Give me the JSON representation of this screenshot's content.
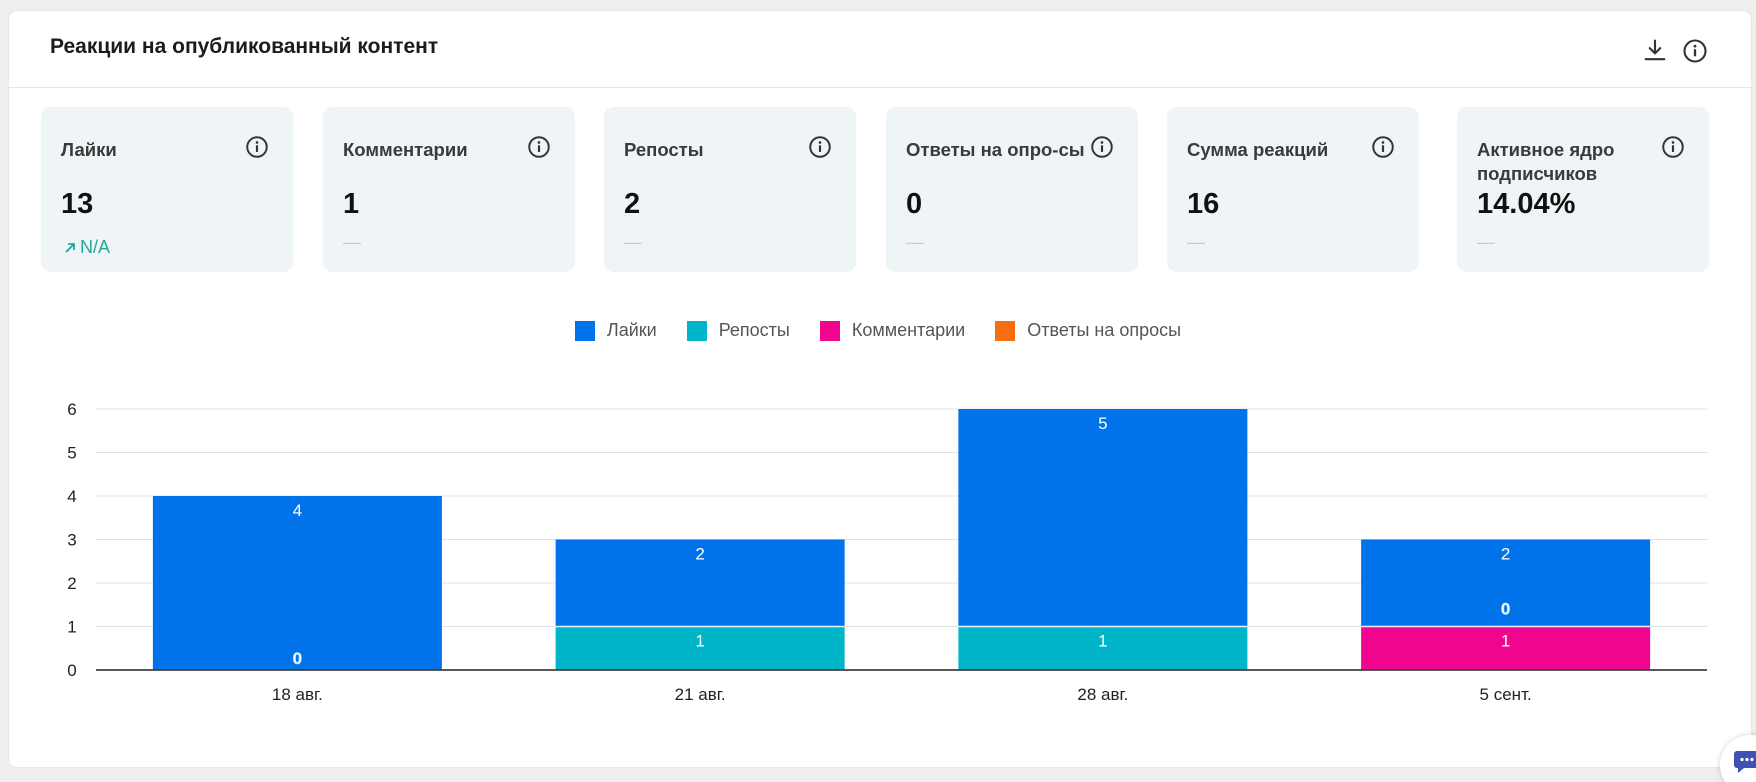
{
  "title": "Реакции на опубликованный контент",
  "icons": {
    "download": "download-icon",
    "info": "info-icon"
  },
  "metrics": [
    {
      "label": "Лайки",
      "value": "13",
      "trend": "N/A",
      "trend_icon": "arrow-up-right-icon"
    },
    {
      "label": "Комментарии",
      "value": "1",
      "trend": "—"
    },
    {
      "label": "Репосты",
      "value": "2",
      "trend": "—"
    },
    {
      "label": "Ответы на опро-сы",
      "value": "0",
      "trend": "—"
    },
    {
      "label": "Сумма реакций",
      "value": "16",
      "trend": "—"
    },
    {
      "label": "Активное ядро подписчиков",
      "value": "14.04%",
      "trend": "—"
    }
  ],
  "colors": {
    "likes": "#0073ea",
    "reposts": "#00b5c8",
    "comments": "#f0058e",
    "polls": "#f56e0f",
    "trend": "#26a69a"
  },
  "legend": [
    {
      "label": "Лайки",
      "color": "#0073ea"
    },
    {
      "label": "Репосты",
      "color": "#00b5c8"
    },
    {
      "label": "Комментарии",
      "color": "#f0058e"
    },
    {
      "label": "Ответы на опросы",
      "color": "#f56e0f"
    }
  ],
  "chart_data": {
    "type": "bar",
    "stacked": true,
    "categories": [
      "18 авг.",
      "21 авг.",
      "28 авг.",
      "5 сент."
    ],
    "series": [
      {
        "name": "Ответы на опросы",
        "color": "#f56e0f",
        "values": [
          0,
          0,
          0,
          0
        ]
      },
      {
        "name": "Комментарии",
        "color": "#f0058e",
        "values": [
          0,
          0,
          0,
          1
        ]
      },
      {
        "name": "Репосты",
        "color": "#00b5c8",
        "values": [
          0,
          1,
          1,
          0
        ]
      },
      {
        "name": "Лайки",
        "color": "#0073ea",
        "values": [
          4,
          2,
          5,
          2
        ]
      }
    ],
    "zero_labels": [
      {
        "category": "18 авг.",
        "label": "0"
      },
      {
        "category": "5 сент.",
        "label": "0"
      }
    ],
    "yticks": [
      0,
      1,
      2,
      3,
      4,
      5,
      6
    ],
    "ylim": [
      0,
      6
    ],
    "grid": true,
    "legend_position": "top"
  }
}
